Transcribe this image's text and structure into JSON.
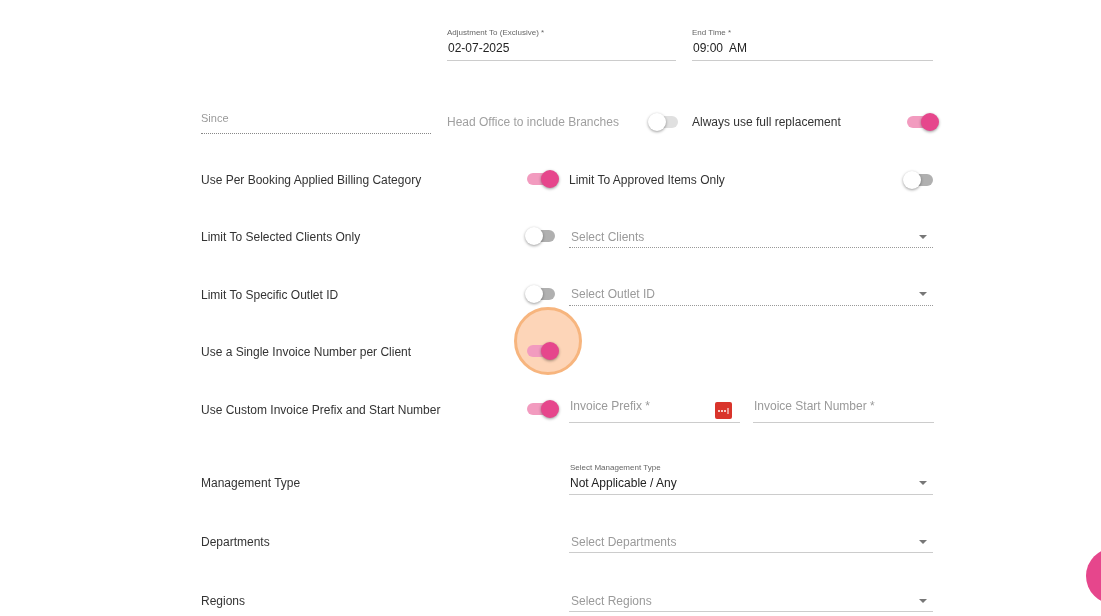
{
  "top_fields": [
    {
      "label": "Adjustment To (Exclusive) *",
      "value": "02-07-2025"
    },
    {
      "label": "End Time *",
      "value": "09:00  AM"
    }
  ],
  "since": {
    "placeholder": "Since"
  },
  "head_office": {
    "label": "Head Office to include Branches",
    "on": false,
    "disabled": true
  },
  "full_replacement": {
    "label": "Always use full replacement",
    "on": true
  },
  "rows": [
    {
      "label": "Use Per Booking Applied Billing Category",
      "on": true,
      "right": {
        "kind": "toggle",
        "label": "Limit To Approved Items Only",
        "on": false
      }
    },
    {
      "label": "Limit To Selected Clients Only",
      "on": false,
      "right": {
        "kind": "select",
        "placeholder": "Select Clients",
        "dotted": true
      }
    },
    {
      "label": "Limit To Specific Outlet ID",
      "on": false,
      "right": {
        "kind": "select",
        "placeholder": "Select Outlet ID",
        "dotted": true
      }
    },
    {
      "label": "Use a Single Invoice Number per Client",
      "on": true,
      "clicked": true
    },
    {
      "label": "Use Custom Invoice Prefix and Start Number",
      "on": true,
      "right": {
        "kind": "invoice",
        "prefix_placeholder": "Invoice Prefix *",
        "start_placeholder": "Invoice Start Number *"
      }
    }
  ],
  "selects": [
    {
      "label": "Management Type",
      "field_label": "Select Management Type",
      "value": "Not Applicable / Any"
    },
    {
      "label": "Departments",
      "placeholder": "Select Departments"
    },
    {
      "label": "Regions",
      "placeholder": "Select Regions"
    }
  ]
}
